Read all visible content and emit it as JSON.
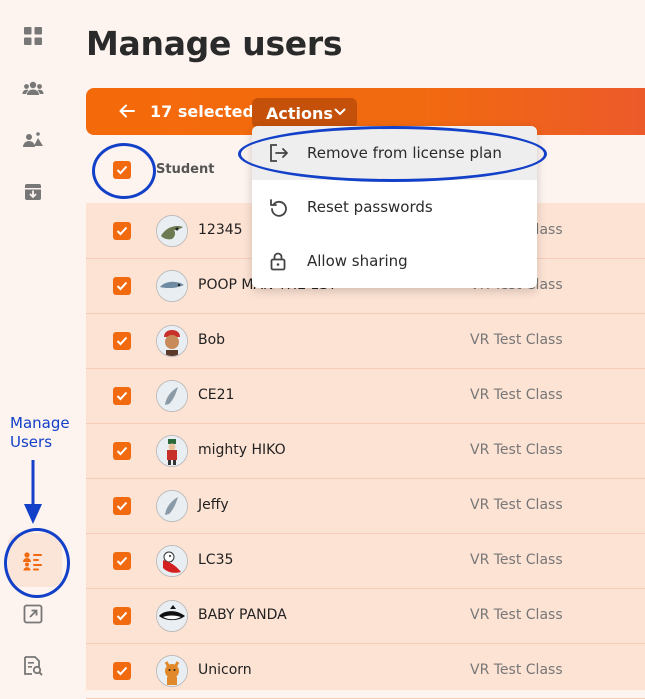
{
  "page": {
    "title": "Manage users"
  },
  "selection_bar": {
    "count_text": "17 selected",
    "actions_label": "Actions"
  },
  "table": {
    "header": "Student",
    "rows": [
      {
        "name": "12345",
        "class": "VR Test Class"
      },
      {
        "name": "POOP MAN THE 1ST",
        "class": "VR Test Class"
      },
      {
        "name": "Bob",
        "class": "VR Test Class"
      },
      {
        "name": "CE21",
        "class": "VR Test Class"
      },
      {
        "name": "mighty HIKO",
        "class": "VR Test Class"
      },
      {
        "name": "Jeffy",
        "class": "VR Test Class"
      },
      {
        "name": "LC35",
        "class": "VR Test Class"
      },
      {
        "name": "BABY PANDA",
        "class": "VR Test Class"
      },
      {
        "name": "Unicorn",
        "class": "VR Test Class"
      }
    ]
  },
  "actions_menu": {
    "items": [
      {
        "label": "Remove from license plan",
        "icon": "exit-icon"
      },
      {
        "label": "Reset passwords",
        "icon": "reset-icon"
      },
      {
        "label": "Allow sharing",
        "icon": "lock-icon"
      }
    ]
  },
  "annotation": {
    "line1": "Manage",
    "line2": "Users"
  },
  "colors": {
    "accent": "#f26a10",
    "annotation": "#1340c8",
    "row_bg": "#fde3d4"
  }
}
